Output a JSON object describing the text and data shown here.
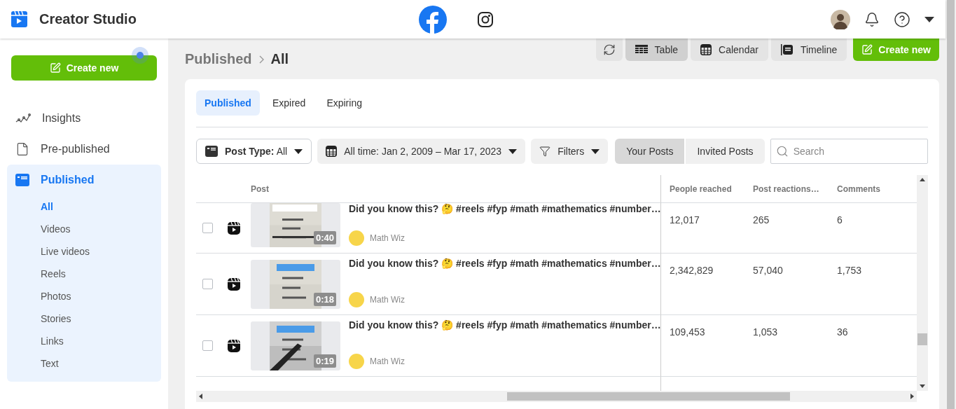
{
  "header": {
    "title": "Creator Studio",
    "platforms": [
      {
        "kind": "facebook",
        "selected": true
      },
      {
        "kind": "instagram",
        "selected": false
      }
    ]
  },
  "sidebar": {
    "create_button": "Create new",
    "items": [
      {
        "kind": "insights",
        "label": "Insights",
        "selected": false
      },
      {
        "kind": "prepublished",
        "label": "Pre-published",
        "selected": false
      },
      {
        "kind": "published",
        "label": "Published",
        "selected": true,
        "children": [
          {
            "label": "All",
            "selected": true
          },
          {
            "label": "Videos",
            "selected": false
          },
          {
            "label": "Live videos",
            "selected": false
          },
          {
            "label": "Reels",
            "selected": false
          },
          {
            "label": "Photos",
            "selected": false
          },
          {
            "label": "Stories",
            "selected": false
          },
          {
            "label": "Links",
            "selected": false
          },
          {
            "label": "Text",
            "selected": false
          }
        ]
      }
    ]
  },
  "breadcrumb": [
    "Published",
    "All"
  ],
  "view_buttons": [
    {
      "kind": "table",
      "label": "Table",
      "selected": true
    },
    {
      "kind": "calendar",
      "label": "Calendar",
      "selected": false
    },
    {
      "kind": "timeline",
      "label": "Timeline",
      "selected": false
    }
  ],
  "create_button": "Create new",
  "tabs": [
    {
      "label": "Published",
      "selected": true
    },
    {
      "label": "Expired",
      "selected": false
    },
    {
      "label": "Expiring",
      "selected": false
    }
  ],
  "filters": {
    "post_type": {
      "label": "Post Type:",
      "value": "All"
    },
    "date_range": "All time: Jan 2, 2009 – Mar 17, 2023",
    "more": "Filters"
  },
  "owner_toggle": [
    {
      "label": "Your Posts",
      "selected": true
    },
    {
      "label": "Invited Posts",
      "selected": false
    }
  ],
  "search": {
    "placeholder": "Search"
  },
  "table": {
    "columns": [
      "Post",
      "People reached",
      "Post reactions…",
      "Comments"
    ],
    "rows": [
      {
        "checked": false,
        "title": "Did you know this? 🤔 #reels #fyp #math #mathematics #number…",
        "duration": "0:40",
        "author": "Math Wiz",
        "people_reached": "12,017",
        "reactions": "265",
        "comments": "6"
      },
      {
        "checked": false,
        "title": "Did you know this? 🤔 #reels #fyp #math #mathematics #number…",
        "duration": "0:18",
        "author": "Math Wiz",
        "people_reached": "2,342,829",
        "reactions": "57,040",
        "comments": "1,753"
      },
      {
        "checked": false,
        "title": "Did you know this? 🤔 #reels #fyp #math #mathematics #number…",
        "duration": "0:19",
        "author": "Math Wiz",
        "people_reached": "109,453",
        "reactions": "1,053",
        "comments": "36"
      }
    ]
  }
}
